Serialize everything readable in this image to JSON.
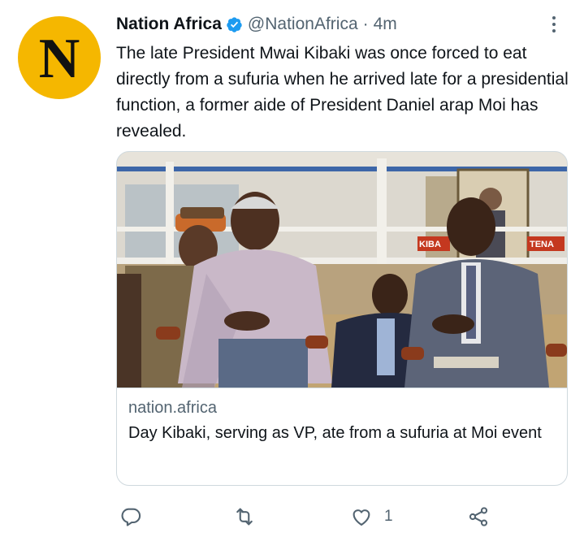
{
  "tweet": {
    "avatar_letter": "N",
    "display_name": "Nation Africa",
    "handle": "@NationAfrica",
    "separator": "·",
    "time": "4m",
    "text": "The late President Mwai Kibaki was once forced to eat directly from a sufuria when he arrived late for a presidential function, a former aide of President Daniel arap Moi has revealed."
  },
  "card": {
    "domain": "nation.africa",
    "title": "Day Kibaki, serving as VP, ate from a sufuria at Moi event",
    "photo_sign_left": "KIBA",
    "photo_sign_right": "TENA"
  },
  "actions": {
    "reply_icon": "reply-icon",
    "retweet_icon": "retweet-icon",
    "like_icon": "like-icon",
    "like_count": "1",
    "share_icon": "share-icon"
  },
  "colors": {
    "avatar_bg": "#f5b700",
    "verified": "#1d9bf0",
    "secondary_text": "#536471",
    "primary_text": "#0f1419"
  }
}
